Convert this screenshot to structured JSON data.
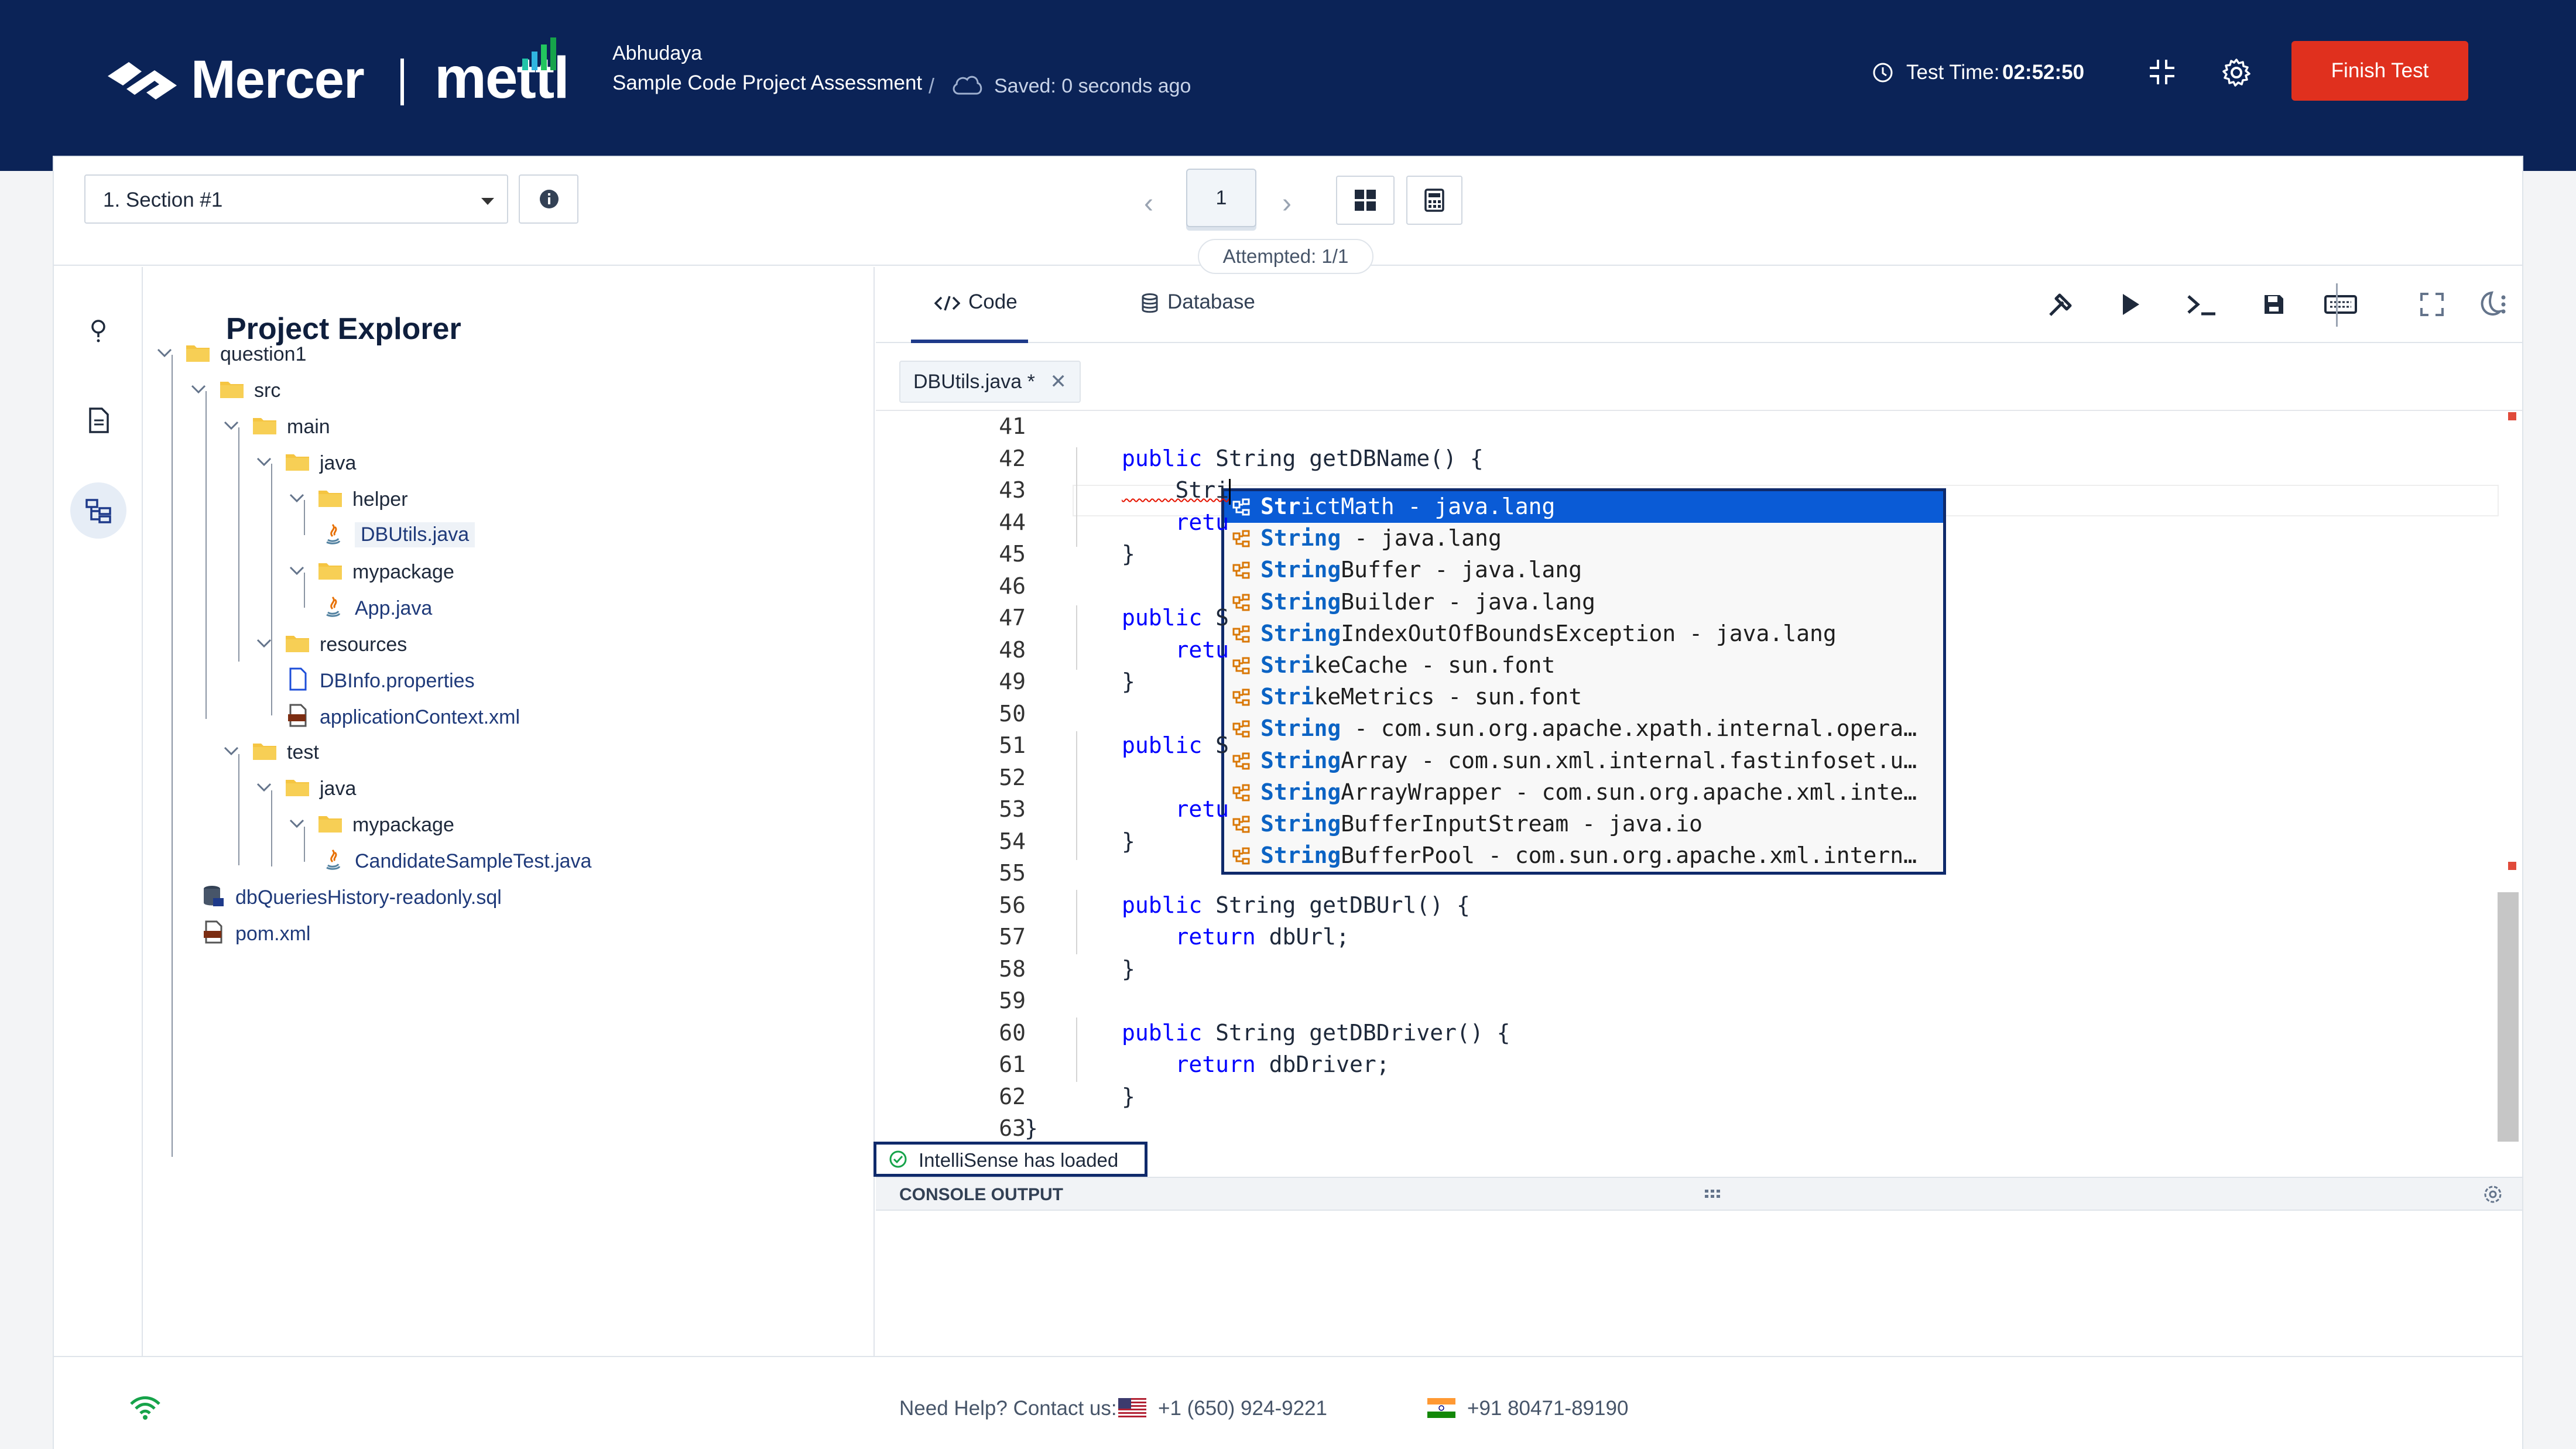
{
  "header": {
    "brand": "Mercer",
    "product": "mettl",
    "user_name": "Abhudaya",
    "project_name": "Sample Code Project Assessment",
    "separator": "/",
    "saved_status": "Saved: 0 seconds ago",
    "test_time_label": "Test Time:",
    "test_time_value": "02:52:50",
    "finish_label": "Finish Test"
  },
  "toolbar": {
    "section_selected": "1. Section #1",
    "current_page": "1",
    "prev_icon": "chevron-left-icon",
    "next_icon": "chevron-right-icon",
    "attempted": "Attempted: 1/1"
  },
  "sidebar": {
    "icons": [
      "question-icon",
      "document-icon",
      "project-tree-icon"
    ],
    "active_index": 2
  },
  "explorer": {
    "title": "Project Explorer",
    "items": [
      {
        "label": "question1",
        "type": "folder"
      },
      {
        "label": "src",
        "type": "folder"
      },
      {
        "label": "main",
        "type": "folder"
      },
      {
        "label": "java",
        "type": "folder"
      },
      {
        "label": "helper",
        "type": "folder"
      },
      {
        "label": "DBUtils.java",
        "type": "java"
      },
      {
        "label": "mypackage",
        "type": "folder"
      },
      {
        "label": "App.java",
        "type": "java"
      },
      {
        "label": "resources",
        "type": "folder"
      },
      {
        "label": "DBInfo.properties",
        "type": "properties"
      },
      {
        "label": "applicationContext.xml",
        "type": "xml"
      },
      {
        "label": "test",
        "type": "folder"
      },
      {
        "label": "java",
        "type": "folder"
      },
      {
        "label": "mypackage",
        "type": "folder"
      },
      {
        "label": "CandidateSampleTest.java",
        "type": "java"
      },
      {
        "label": "dbQueriesHistory-readonly.sql",
        "type": "sql"
      },
      {
        "label": "pom.xml",
        "type": "xml"
      }
    ]
  },
  "editor": {
    "tabs": [
      {
        "label": "Code",
        "icon": "code-icon"
      },
      {
        "label": "Database",
        "icon": "database-icon"
      }
    ],
    "tools": [
      "build-icon",
      "run-icon",
      "terminal-icon",
      "save-icon",
      "keyboard-icon",
      "fullscreen-icon",
      "theme-moon-icon",
      "more-icon"
    ],
    "open_file": "DBUtils.java",
    "open_file_modified": "*",
    "line_numbers": [
      "41",
      "42",
      "43",
      "44",
      "45",
      "46",
      "47",
      "48",
      "49",
      "50",
      "51",
      "52",
      "53",
      "54",
      "55",
      "56",
      "57",
      "58",
      "59",
      "60",
      "61",
      "62",
      "63"
    ],
    "lines": [
      "",
      "public String getDBName() {",
      "    Stri",
      "    retu",
      "}",
      "",
      "public S",
      "    retu",
      "}",
      "",
      "public S",
      "",
      "    retu",
      "}",
      "",
      "public String getDBUrl() {",
      "    return dbUrl;",
      "}",
      "",
      "public String getDBDriver() {",
      "    return dbDriver;",
      "}",
      "}"
    ],
    "suggestions": [
      {
        "match": "Str",
        "rest": "ictMath - java.lang"
      },
      {
        "match": "String",
        "rest": " - java.lang"
      },
      {
        "match": "String",
        "rest": "Buffer - java.lang"
      },
      {
        "match": "String",
        "rest": "Builder - java.lang"
      },
      {
        "match": "String",
        "rest": "IndexOutOfBoundsException - java.lang"
      },
      {
        "match": "Stri",
        "rest": "keCache - sun.font"
      },
      {
        "match": "Stri",
        "rest": "keMetrics - sun.font"
      },
      {
        "match": "String",
        "rest": " - com.sun.org.apache.xpath.internal.opera…"
      },
      {
        "match": "String",
        "rest": "Array - com.sun.xml.internal.fastinfoset.u…"
      },
      {
        "match": "String",
        "rest": "ArrayWrapper - com.sun.org.apache.xml.inte…"
      },
      {
        "match": "String",
        "rest": "BufferInputStream - java.io"
      },
      {
        "match": "String",
        "rest": "BufferPool - com.sun.org.apache.xml.intern…"
      }
    ],
    "intellisense_status": "IntelliSense has loaded",
    "console_title": "CONSOLE OUTPUT"
  },
  "footer": {
    "help_label": "Need Help? Contact us:",
    "phone_us": "+1 (650) 924-9221",
    "phone_in": "+91 80471-89190"
  },
  "colors": {
    "header_bg": "#0b2357",
    "finish_button": "#e0301e",
    "accent": "#0a5bd6",
    "keyword": "#0000ff"
  }
}
